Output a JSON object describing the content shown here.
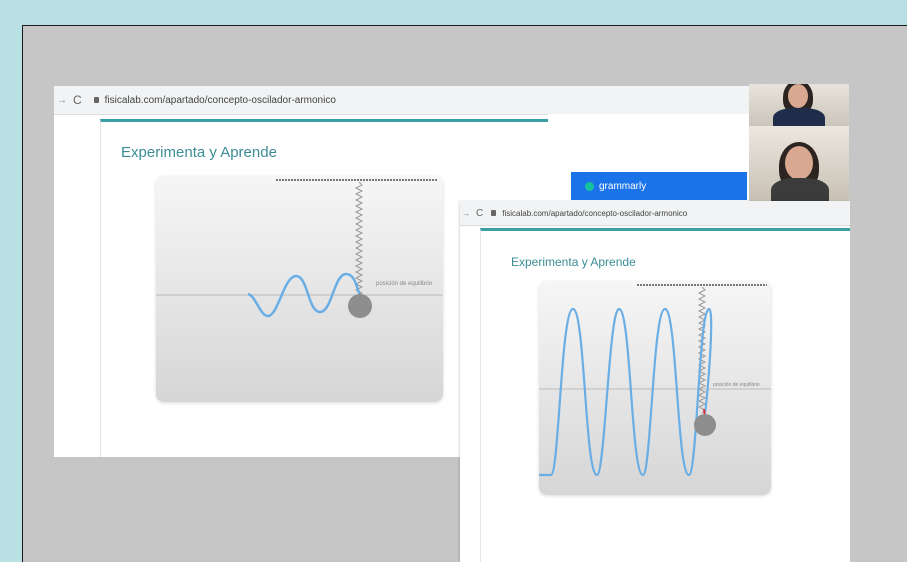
{
  "browser_back": {
    "url": "fisicalab.com/apartado/concepto-oscilador-armonico",
    "heading": "Experimenta y Aprende",
    "equilibrium_label": "posición de equilibrio"
  },
  "browser_front": {
    "url": "fisicalab.com/apartado/concepto-oscilador-armonico",
    "heading": "Experimenta y Aprende",
    "equilibrium_label": "posición de equilibrio"
  },
  "grammarly": {
    "label": "grammarly"
  },
  "icons": {
    "nav_arrow": "→",
    "reload": "C",
    "cursor": "⇱"
  },
  "colors": {
    "accent_teal": "#3aa0a6",
    "wave_blue": "#6aaee6",
    "page_background": "#b9e0e3",
    "frame_gray": "#c6c6c6"
  }
}
